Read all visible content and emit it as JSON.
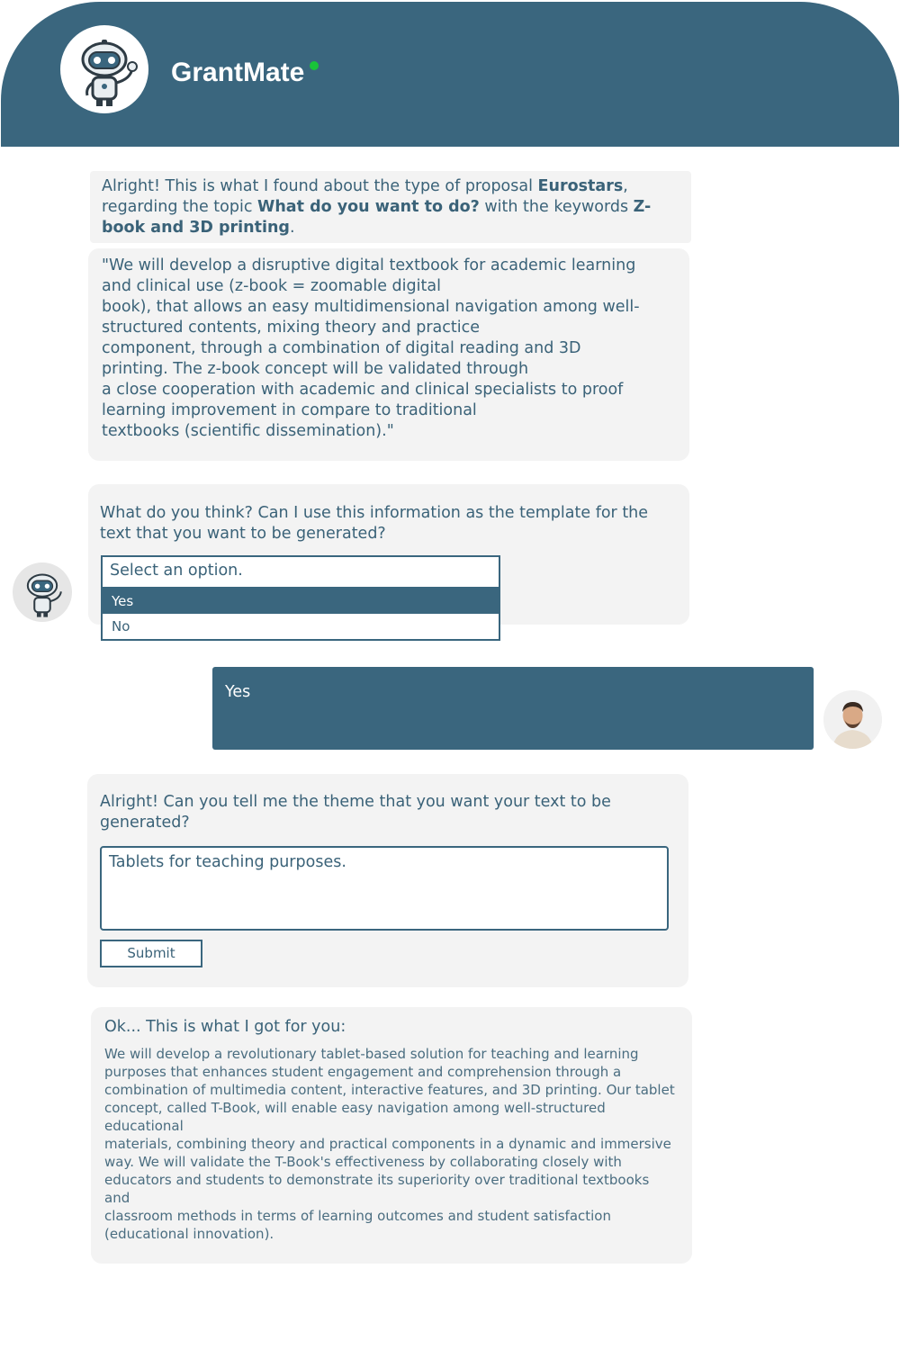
{
  "header": {
    "title": "GrantMate",
    "status_color": "#19c43a"
  },
  "intro": {
    "prefix": "Alright! This is what I found about the type of proposal ",
    "proposal": "Eurostars",
    "mid1": ", regarding the topic ",
    "topic": "What do you want to do?",
    "mid2": " with the keywords ",
    "keywords": "Z-book and 3D printing",
    "suffix": "."
  },
  "quote_lines": [
    "\"We will develop a disruptive digital textbook for academic learning",
    "and clinical use (z-book = zoomable digital",
    "book), that allows an easy multidimensional navigation among well-",
    "structured contents, mixing theory and practice",
    "component, through a combination of digital reading and 3D",
    "printing. The z-book concept will be validated through",
    "a close cooperation with academic and clinical specialists to proof",
    "learning improvement in compare to traditional",
    "textbooks (scientific dissemination).\""
  ],
  "question1": "What do you think? Can I use this information as the template for the text that you want to be generated?",
  "select": {
    "placeholder": "Select an option.",
    "options": [
      "Yes",
      "No"
    ],
    "highlighted": "Yes"
  },
  "user_reply": "Yes",
  "question2": "Alright! Can you tell me the theme that you want your text to be generated?",
  "theme_input": {
    "value": "Tablets for teaching purposes."
  },
  "submit_label": "Submit",
  "result": {
    "heading": "Ok... This is what I got for you:",
    "lines": [
      "We will develop a revolutionary tablet-based solution for teaching and learning",
      "purposes that enhances student engagement and comprehension through a",
      "combination of multimedia content, interactive features, and 3D printing. Our tablet",
      "concept, called T-Book, will enable easy navigation among well-structured educational",
      "materials, combining theory and practical components in a dynamic and immersive",
      "way. We will validate the T-Book's effectiveness by collaborating closely with",
      "educators and students to demonstrate its superiority over traditional textbooks and",
      "classroom methods in terms of learning outcomes and student satisfaction",
      "(educational innovation)."
    ]
  },
  "colors": {
    "primary": "#3a667e",
    "bubble": "#f3f3f3"
  },
  "icons": {
    "bot_avatar": "robot-avatar-icon",
    "user_avatar": "user-avatar-icon"
  }
}
